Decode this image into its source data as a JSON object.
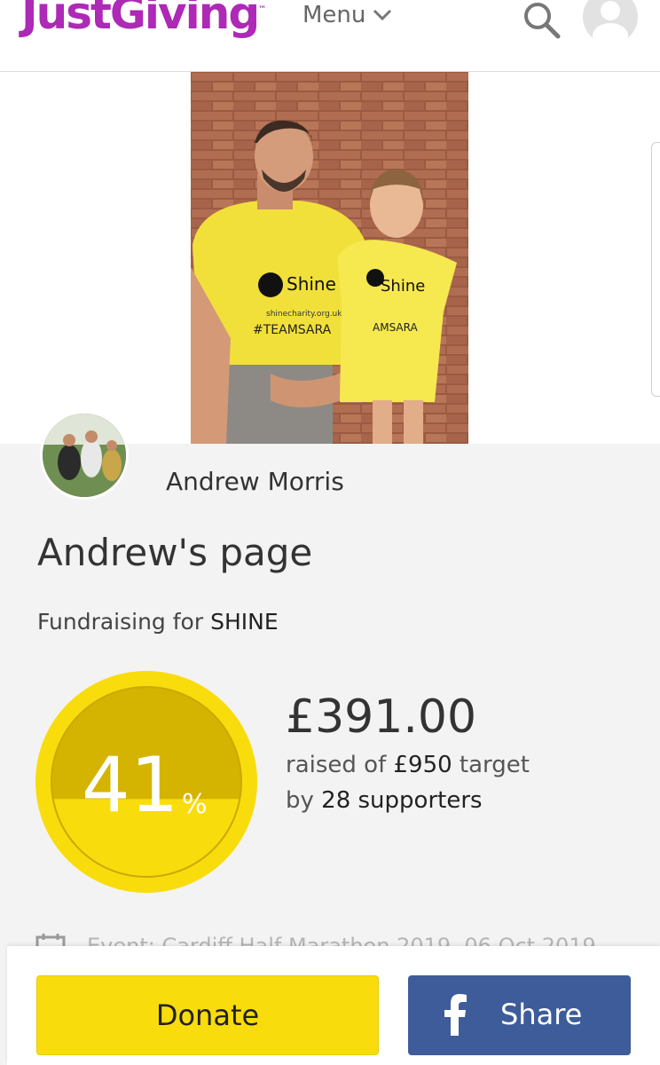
{
  "header": {
    "logo": "JustGiving",
    "logo_tm": "™",
    "menu_label": "Menu",
    "icons": [
      "chevron-down-icon",
      "search-icon",
      "user-icon"
    ],
    "brand_color": "#ad29b6"
  },
  "hero": {
    "shirt_brand": "Shine",
    "shirt_url": "shinecharity.org.uk",
    "shirt_tag": "#TEAMSARA"
  },
  "profile": {
    "owner_name": "Andrew Morris",
    "page_title": "Andrew's page",
    "fundraising_prefix": "Fundraising for",
    "charity": "SHINE"
  },
  "progress": {
    "percent": 41,
    "percent_label": "41",
    "percent_sign": "%",
    "ring_color": "#f9dc0c",
    "fill_color": "#d4b400"
  },
  "totals": {
    "raised": "£391.00",
    "raised_prefix": "raised of",
    "target": "£950",
    "target_suffix": "target",
    "by_prefix": "by",
    "supporters": "28 supporters"
  },
  "event": {
    "text": "Event: Cardiff Half Marathon 2019, 06 Oct 2019"
  },
  "actions": {
    "donate_label": "Donate",
    "share_label": "Share",
    "donate_color": "#f9dc0c",
    "share_color": "#3e5c9a"
  }
}
